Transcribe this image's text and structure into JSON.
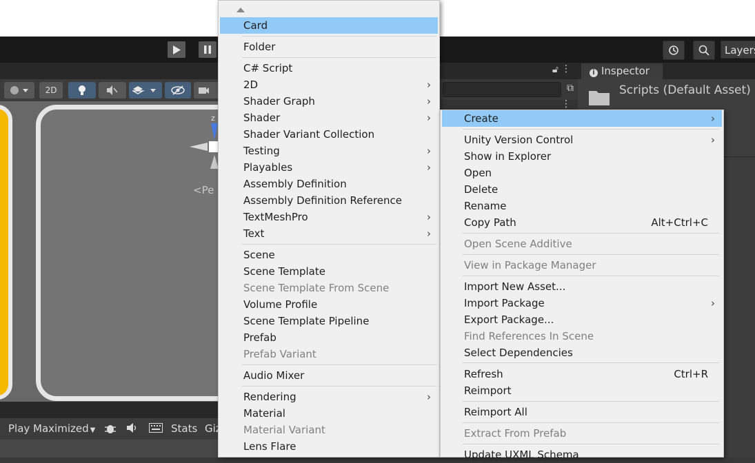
{
  "toolbar": {
    "play_icon": "play-icon",
    "pause_icon": "pause-icon",
    "history_icon": "history-icon",
    "search_icon": "search-icon",
    "layers_label": "Layers"
  },
  "scene": {
    "mode_2d_label": "2D",
    "gizmo_axis_label": "z",
    "gizmo_persp_label": "<Pe"
  },
  "game_bar": {
    "play_maximized_label": "Play Maximized",
    "stats_label": "Stats",
    "gizmos_label": "Giz"
  },
  "inspector": {
    "tab_label": "Inspector",
    "title": "Scripts (Default Asset)"
  },
  "create_menu": {
    "scroll_up_icon": "scroll-up-arrow-icon",
    "items": [
      {
        "label": "Card",
        "highlighted": true,
        "submenu": false,
        "enabled": true
      },
      {
        "label": "Folder",
        "submenu": false,
        "enabled": true
      },
      {
        "label": "C# Script",
        "submenu": false,
        "enabled": true
      },
      {
        "label": "2D",
        "submenu": true,
        "enabled": true
      },
      {
        "label": "Shader Graph",
        "submenu": true,
        "enabled": true
      },
      {
        "label": "Shader",
        "submenu": true,
        "enabled": true
      },
      {
        "label": "Shader Variant Collection",
        "submenu": false,
        "enabled": true
      },
      {
        "label": "Testing",
        "submenu": true,
        "enabled": true
      },
      {
        "label": "Playables",
        "submenu": true,
        "enabled": true
      },
      {
        "label": "Assembly Definition",
        "submenu": false,
        "enabled": true
      },
      {
        "label": "Assembly Definition Reference",
        "submenu": false,
        "enabled": true
      },
      {
        "label": "TextMeshPro",
        "submenu": true,
        "enabled": true
      },
      {
        "label": "Text",
        "submenu": true,
        "enabled": true
      },
      {
        "label": "Scene",
        "submenu": false,
        "enabled": true
      },
      {
        "label": "Scene Template",
        "submenu": false,
        "enabled": true
      },
      {
        "label": "Scene Template From Scene",
        "submenu": false,
        "enabled": false
      },
      {
        "label": "Volume Profile",
        "submenu": false,
        "enabled": true
      },
      {
        "label": "Scene Template Pipeline",
        "submenu": false,
        "enabled": true
      },
      {
        "label": "Prefab",
        "submenu": false,
        "enabled": true
      },
      {
        "label": "Prefab Variant",
        "submenu": false,
        "enabled": false
      },
      {
        "label": "Audio Mixer",
        "submenu": false,
        "enabled": true
      },
      {
        "label": "Rendering",
        "submenu": true,
        "enabled": true
      },
      {
        "label": "Material",
        "submenu": false,
        "enabled": true
      },
      {
        "label": "Material Variant",
        "submenu": false,
        "enabled": false
      },
      {
        "label": "Lens Flare",
        "submenu": false,
        "enabled": true
      }
    ]
  },
  "context_menu": {
    "items": [
      {
        "label": "Create",
        "highlighted": true,
        "submenu": true,
        "enabled": true
      },
      {
        "label": "Unity Version Control",
        "submenu": true,
        "enabled": true
      },
      {
        "label": "Show in Explorer",
        "submenu": false,
        "enabled": true
      },
      {
        "label": "Open",
        "submenu": false,
        "enabled": true
      },
      {
        "label": "Delete",
        "submenu": false,
        "enabled": true
      },
      {
        "label": "Rename",
        "submenu": false,
        "enabled": true
      },
      {
        "label": "Copy Path",
        "shortcut": "Alt+Ctrl+C",
        "submenu": false,
        "enabled": true
      },
      {
        "label": "Open Scene Additive",
        "submenu": false,
        "enabled": false
      },
      {
        "label": "View in Package Manager",
        "submenu": false,
        "enabled": false
      },
      {
        "label": "Import New Asset...",
        "submenu": false,
        "enabled": true
      },
      {
        "label": "Import Package",
        "submenu": true,
        "enabled": true
      },
      {
        "label": "Export Package...",
        "submenu": false,
        "enabled": true
      },
      {
        "label": "Find References In Scene",
        "submenu": false,
        "enabled": false
      },
      {
        "label": "Select Dependencies",
        "submenu": false,
        "enabled": true
      },
      {
        "label": "Refresh",
        "shortcut": "Ctrl+R",
        "submenu": false,
        "enabled": true
      },
      {
        "label": "Reimport",
        "submenu": false,
        "enabled": true
      },
      {
        "label": "Reimport All",
        "submenu": false,
        "enabled": true
      },
      {
        "label": "Extract From Prefab",
        "submenu": false,
        "enabled": false
      },
      {
        "label": "Update UXML Schema",
        "submenu": false,
        "enabled": true
      }
    ]
  },
  "colors": {
    "menu_bg": "#f0f0f0",
    "highlight": "#91c9f7",
    "disabled_text": "#808080",
    "editor_dark": "#191919",
    "accent_yellow": "#f5b800"
  }
}
